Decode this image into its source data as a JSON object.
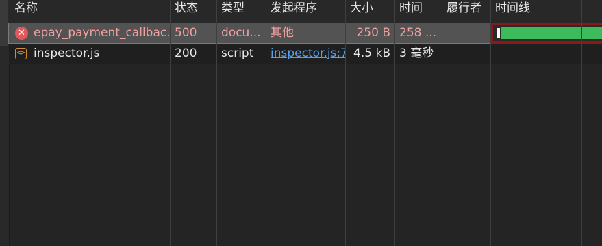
{
  "columns": [
    "名称",
    "状态",
    "类型",
    "发起程序",
    "大小",
    "时间",
    "履行者",
    "时间线"
  ],
  "requests": [
    {
      "name": "epay_payment_callbac...",
      "status": "500",
      "type": "docu...",
      "initiator": "其他",
      "size": "250 B",
      "time": "258 ...",
      "fulfilled_by": "",
      "status_kind": "error",
      "icon": "error-circle-icon"
    },
    {
      "name": "inspector.js",
      "status": "200",
      "type": "script",
      "initiator": "inspector.js:7",
      "size": "4.5 kB",
      "time": "3 毫秒",
      "fulfilled_by": "",
      "status_kind": "ok",
      "icon": "script-file-icon"
    }
  ],
  "colors": {
    "error_text": "#f2a0a0",
    "link": "#5aa0e6",
    "timeline_bar": "#3dba5a",
    "timeline_highlight": "#8a1a1a"
  }
}
